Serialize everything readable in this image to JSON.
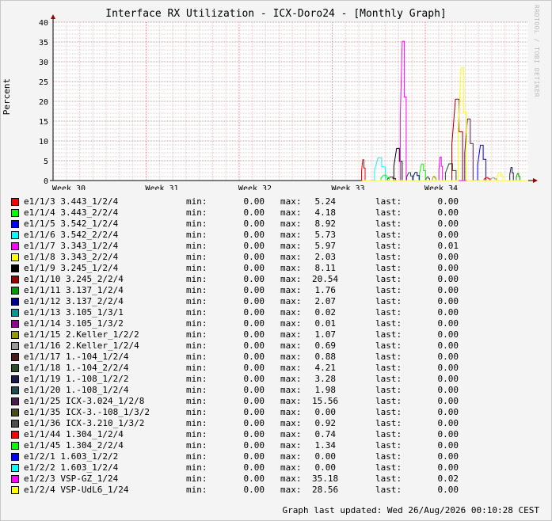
{
  "chart_data": {
    "type": "line",
    "title": "Interface RX Utilization - ICX-Doro24 - [Monthly Graph]",
    "ylabel": "Percent",
    "xlabel": "",
    "ylim": [
      0,
      40
    ],
    "yticks": [
      0,
      5,
      10,
      15,
      20,
      25,
      30,
      35,
      40
    ],
    "x_ticks": [
      "Week 30",
      "Week 31",
      "Week 32",
      "Week 33",
      "Week 34"
    ],
    "grid": true,
    "legend_placement": "bottom",
    "watermark": "RRDTOOL / TOBI OETIKER",
    "last_updated": "Graph last updated: Wed 26/Aug/2026 00:10:28 CEST",
    "stat_labels": {
      "min": "min:",
      "max": "max:",
      "last": "last:"
    },
    "series": [
      {
        "name": "e1/1/3 3.443_1/2/4",
        "color": "#ff0000",
        "min": "0.00",
        "max": "5.24",
        "last": "0.00"
      },
      {
        "name": "e1/1/4 3.443_2/2/4",
        "color": "#00ff00",
        "min": "0.00",
        "max": "4.18",
        "last": "0.00"
      },
      {
        "name": "e1/1/5 3.542_1/2/4",
        "color": "#0000ff",
        "min": "0.00",
        "max": "8.92",
        "last": "0.00"
      },
      {
        "name": "e1/1/6 3.542_2/2/4",
        "color": "#00ffff",
        "min": "0.00",
        "max": "5.73",
        "last": "0.00"
      },
      {
        "name": "e1/1/7 3.343_1/2/4",
        "color": "#ff00ff",
        "min": "0.00",
        "max": "5.97",
        "last": "0.01"
      },
      {
        "name": "e1/1/8 3.343_2/2/4",
        "color": "#ffff00",
        "min": "0.00",
        "max": "2.03",
        "last": "0.00"
      },
      {
        "name": "e1/1/9 3.245_1/2/4",
        "color": "#000000",
        "min": "0.00",
        "max": "8.11",
        "last": "0.00"
      },
      {
        "name": "e1/1/10 3.245_2/2/4",
        "color": "#990000",
        "min": "0.00",
        "max": "20.54",
        "last": "0.00"
      },
      {
        "name": "e1/1/11 3.137_1/2/4",
        "color": "#009900",
        "min": "0.00",
        "max": "1.76",
        "last": "0.00"
      },
      {
        "name": "e1/1/12 3.137_2/2/4",
        "color": "#000099",
        "min": "0.00",
        "max": "2.07",
        "last": "0.00"
      },
      {
        "name": "e1/1/13 3.105_1/3/1",
        "color": "#009999",
        "min": "0.00",
        "max": "0.02",
        "last": "0.00"
      },
      {
        "name": "e1/1/14 3.105_1/3/2",
        "color": "#990099",
        "min": "0.00",
        "max": "0.01",
        "last": "0.00"
      },
      {
        "name": "e1/1/15 2.Keller_1/2/2",
        "color": "#999900",
        "min": "0.00",
        "max": "1.07",
        "last": "0.00"
      },
      {
        "name": "e1/1/16 2.Keller_1/2/4",
        "color": "#999999",
        "min": "0.00",
        "max": "0.69",
        "last": "0.00"
      },
      {
        "name": "e1/1/17 1.-104_1/2/4",
        "color": "#4d1a1a",
        "min": "0.00",
        "max": "0.88",
        "last": "0.00"
      },
      {
        "name": "e1/1/18 1.-104_2/2/4",
        "color": "#2a4d2a",
        "min": "0.00",
        "max": "4.21",
        "last": "0.00"
      },
      {
        "name": "e1/1/19 1.-108_1/2/2",
        "color": "#1a1a4d",
        "min": "0.00",
        "max": "3.28",
        "last": "0.00"
      },
      {
        "name": "e1/1/20 1.-108_1/2/4",
        "color": "#1a4d4d",
        "min": "0.00",
        "max": "1.98",
        "last": "0.00"
      },
      {
        "name": "e1/1/25 ICX-3.024_1/2/8",
        "color": "#4d1a4d",
        "min": "0.00",
        "max": "15.56",
        "last": "0.00"
      },
      {
        "name": "e1/1/35 ICX-3.-108_1/3/2",
        "color": "#4d4d1a",
        "min": "0.00",
        "max": "0.00",
        "last": "0.00"
      },
      {
        "name": "e1/1/36 ICX-3.210_1/3/2",
        "color": "#4d4d4d",
        "min": "0.00",
        "max": "0.92",
        "last": "0.00"
      },
      {
        "name": "e1/1/44 1.304_1/2/4",
        "color": "#ff0000",
        "min": "0.00",
        "max": "0.74",
        "last": "0.00"
      },
      {
        "name": "e1/1/45 1.304_2/2/4",
        "color": "#00ff00",
        "min": "0.00",
        "max": "1.34",
        "last": "0.00"
      },
      {
        "name": "e1/2/1 1.603_1/2/2",
        "color": "#0000ff",
        "min": "0.00",
        "max": "0.00",
        "last": "0.00"
      },
      {
        "name": "e1/2/2 1.603_1/2/4",
        "color": "#00ffff",
        "min": "0.00",
        "max": "0.00",
        "last": "0.00"
      },
      {
        "name": "e1/2/3 VSP-GZ_1/24",
        "color": "#ff00ff",
        "min": "0.00",
        "max": "35.18",
        "last": "0.02"
      },
      {
        "name": "e1/2/4 VSP-UdL6_1/24",
        "color": "#ffff00",
        "min": "0.00",
        "max": "28.56",
        "last": "0.00"
      }
    ]
  }
}
